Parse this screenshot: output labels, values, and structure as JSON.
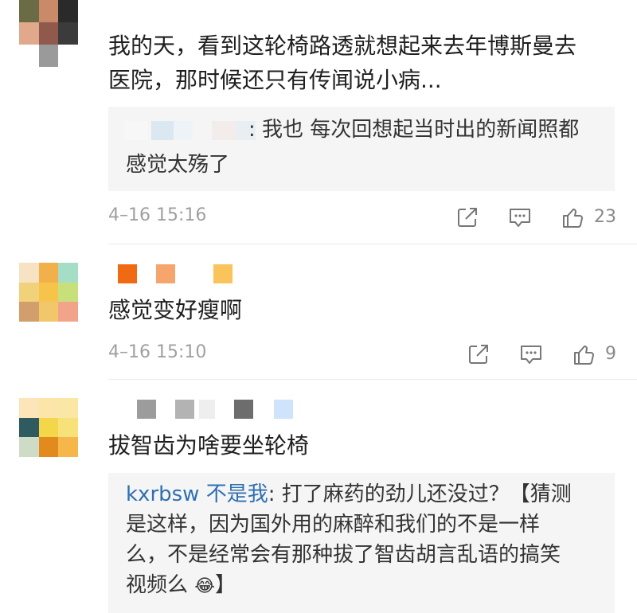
{
  "comments": [
    {
      "text_lines": [
        "我的天，看到这轮椅路透就想起来去年博斯曼去",
        "医院，那时候还只有传闻说小病..."
      ],
      "reply": {
        "name": "",
        "lines": [
          ": 我也 每次回想起当时出的新闻照都",
          "感觉太殇了"
        ]
      },
      "timestamp": "4–16 15:16",
      "likes": "23"
    },
    {
      "text_lines": [
        "感觉变好瘦啊"
      ],
      "timestamp": "4–16 15:10",
      "likes": "9"
    },
    {
      "text_lines": [
        "拔智齿为啥要坐轮椅"
      ],
      "reply": {
        "name": "kxrbsw 不是我",
        "lines": [
          ": 打了麻药的劲儿还没过？【猜测",
          "是这样，因为国外用的麻醉和我们的不是一样",
          "么，不是经常会有那种拔了智齿胡言乱语的搞笑",
          "视频么",
          "】"
        ],
        "emoji": "😂"
      }
    }
  ],
  "icons": [
    "share-icon",
    "comment-icon",
    "like-icon"
  ],
  "colors": {
    "reply_bg": "#f5f5f5",
    "reply_name": "#2f6fb2",
    "meta": "#a0a0a0"
  }
}
